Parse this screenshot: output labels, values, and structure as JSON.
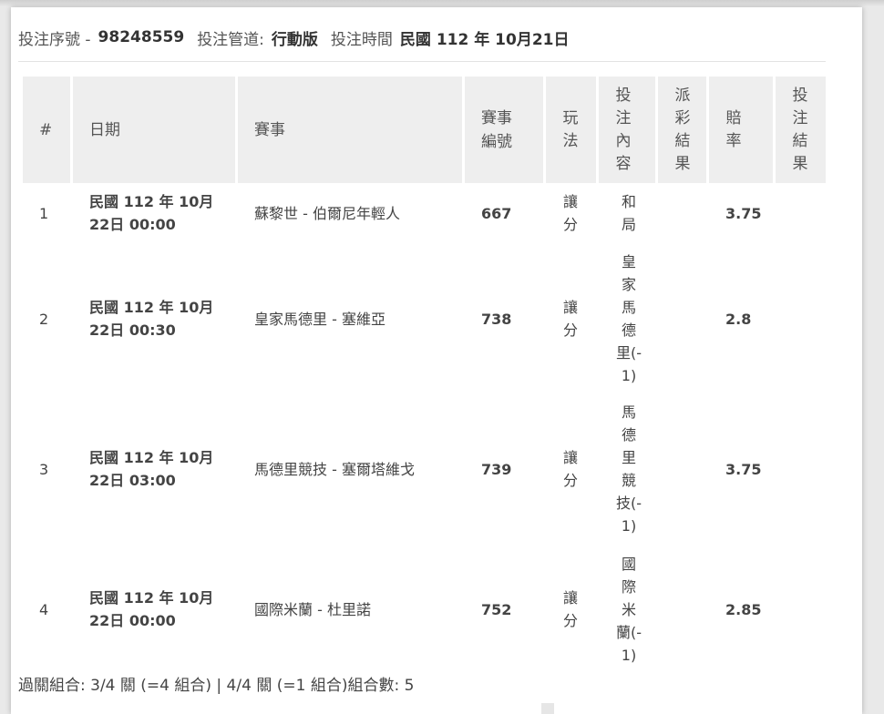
{
  "header": {
    "serial_label": "投注序號 -",
    "serial_value": "98248559",
    "channel_label": "投注管道:",
    "channel_value": "行動版",
    "time_label": "投注時間",
    "time_value": "民國 112 年 10月21日"
  },
  "table": {
    "columns": [
      "#",
      "日期",
      "賽事",
      "賽事編號",
      "玩法",
      "投注內容",
      "派彩結果",
      "賠率",
      "投注結果"
    ],
    "rows": [
      {
        "no": "1",
        "date": "民國 112 年 10月 22日 00:00",
        "match": "蘇黎世 - 伯爾尼年輕人",
        "match_no": "667",
        "play": "讓分",
        "bet": "和局",
        "payout": "",
        "odds": "3.75",
        "result": ""
      },
      {
        "no": "2",
        "date": "民國 112 年 10月 22日 00:30",
        "match": "皇家馬德里 - 塞維亞",
        "match_no": "738",
        "play": "讓分",
        "bet": "皇家馬德里(-1)",
        "payout": "",
        "odds": "2.8",
        "result": ""
      },
      {
        "no": "3",
        "date": "民國 112 年 10月 22日 03:00",
        "match": "馬德里競技 - 塞爾塔維戈",
        "match_no": "739",
        "play": "讓分",
        "bet": "馬德里競技(-1)",
        "payout": "",
        "odds": "3.75",
        "result": ""
      },
      {
        "no": "4",
        "date": "民國 112 年 10月 22日 00:00",
        "match": "國際米蘭 - 杜里諾",
        "match_no": "752",
        "play": "讓分",
        "bet": "國際米蘭(-1)",
        "payout": "",
        "odds": "2.85",
        "result": ""
      }
    ]
  },
  "footer": {
    "text": "過關組合: 3/4 關 (=4 組合) | 4/4 關 (=1 組合)組合數: 5"
  }
}
